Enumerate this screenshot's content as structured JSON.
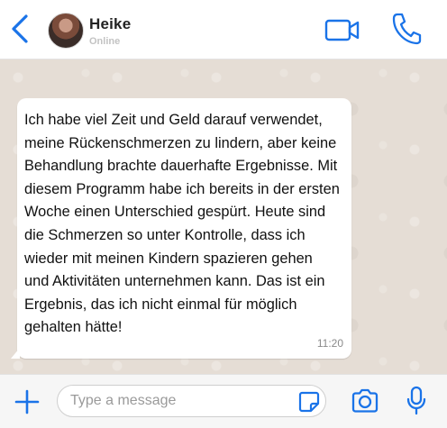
{
  "header": {
    "contact_name": "Heike",
    "status": "Online"
  },
  "message": {
    "text": "Ich habe viel Zeit und Geld darauf verwendet, meine Rückenschmerzen zu lindern, aber keine Behandlung brachte dauerhafte Ergebnisse. Mit diesem Programm habe ich bereits in der ersten Woche einen Unterschied gespürt. Heute sind die Schmerzen so unter Kontrolle, dass ich wieder mit meinen Kindern spazieren gehen und Aktivitäten unternehmen kann. Das ist ein Ergebnis, das ich nicht einmal für möglich gehalten hätte!",
    "time": "11:20"
  },
  "composer": {
    "placeholder": "Type a message"
  },
  "icons": {
    "back": "chevron-left-icon",
    "video": "video-camera-icon",
    "phone": "phone-icon",
    "plus": "plus-icon",
    "sticker": "sticker-icon",
    "camera": "camera-icon",
    "mic": "microphone-icon"
  },
  "colors": {
    "accent": "#1a73e8",
    "chat_background": "#e5ddd5",
    "bubble": "#ffffff"
  }
}
